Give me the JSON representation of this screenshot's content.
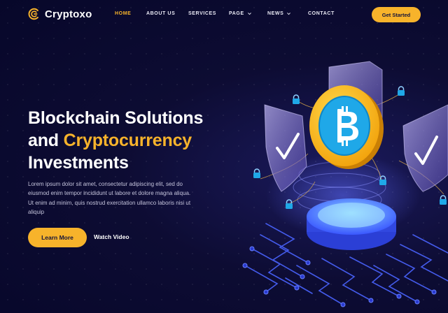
{
  "brand": {
    "name": "Cryptoxo",
    "color": "#f7b32b"
  },
  "nav": {
    "items": [
      {
        "label": "HOME",
        "active": true,
        "dropdown": false
      },
      {
        "label": "ABOUT US",
        "active": false,
        "dropdown": false
      },
      {
        "label": "SERVICES",
        "active": false,
        "dropdown": false
      },
      {
        "label": "PAGE",
        "active": false,
        "dropdown": true
      },
      {
        "label": "NEWS",
        "active": false,
        "dropdown": true
      },
      {
        "label": "CONTACT",
        "active": false,
        "dropdown": false
      }
    ],
    "cta_label": "Get Started"
  },
  "hero": {
    "title_line1": "Blockchain Solutions",
    "title_line2_prefix": "and",
    "title_line2_accent": "Cryptocurrency",
    "title_line3": "Investments",
    "description": "Lorem ipsum dolor sit amet, consectetur adipiscing elit, sed do eiusmod enim tempor incididunt ut labore et dolore magna aliqua. Ut enim ad minim, quis nostrud exercitation ullamco laboris nisi ut aliquip",
    "primary_button": "Learn More",
    "secondary_button": "Watch Video"
  },
  "illustration": {
    "coin_icon": "bitcoin-icon",
    "shield_icons": [
      "shield-check-icon",
      "shield-check-icon",
      "shield-icon"
    ],
    "lock_icons": [
      "lock-icon",
      "lock-icon",
      "lock-icon",
      "lock-icon",
      "lock-icon",
      "lock-icon"
    ]
  },
  "colors": {
    "background": "#0d0c33",
    "accent": "#f7b32b",
    "coin_blue": "#1fa8e8",
    "circuit": "#4a64ff"
  }
}
